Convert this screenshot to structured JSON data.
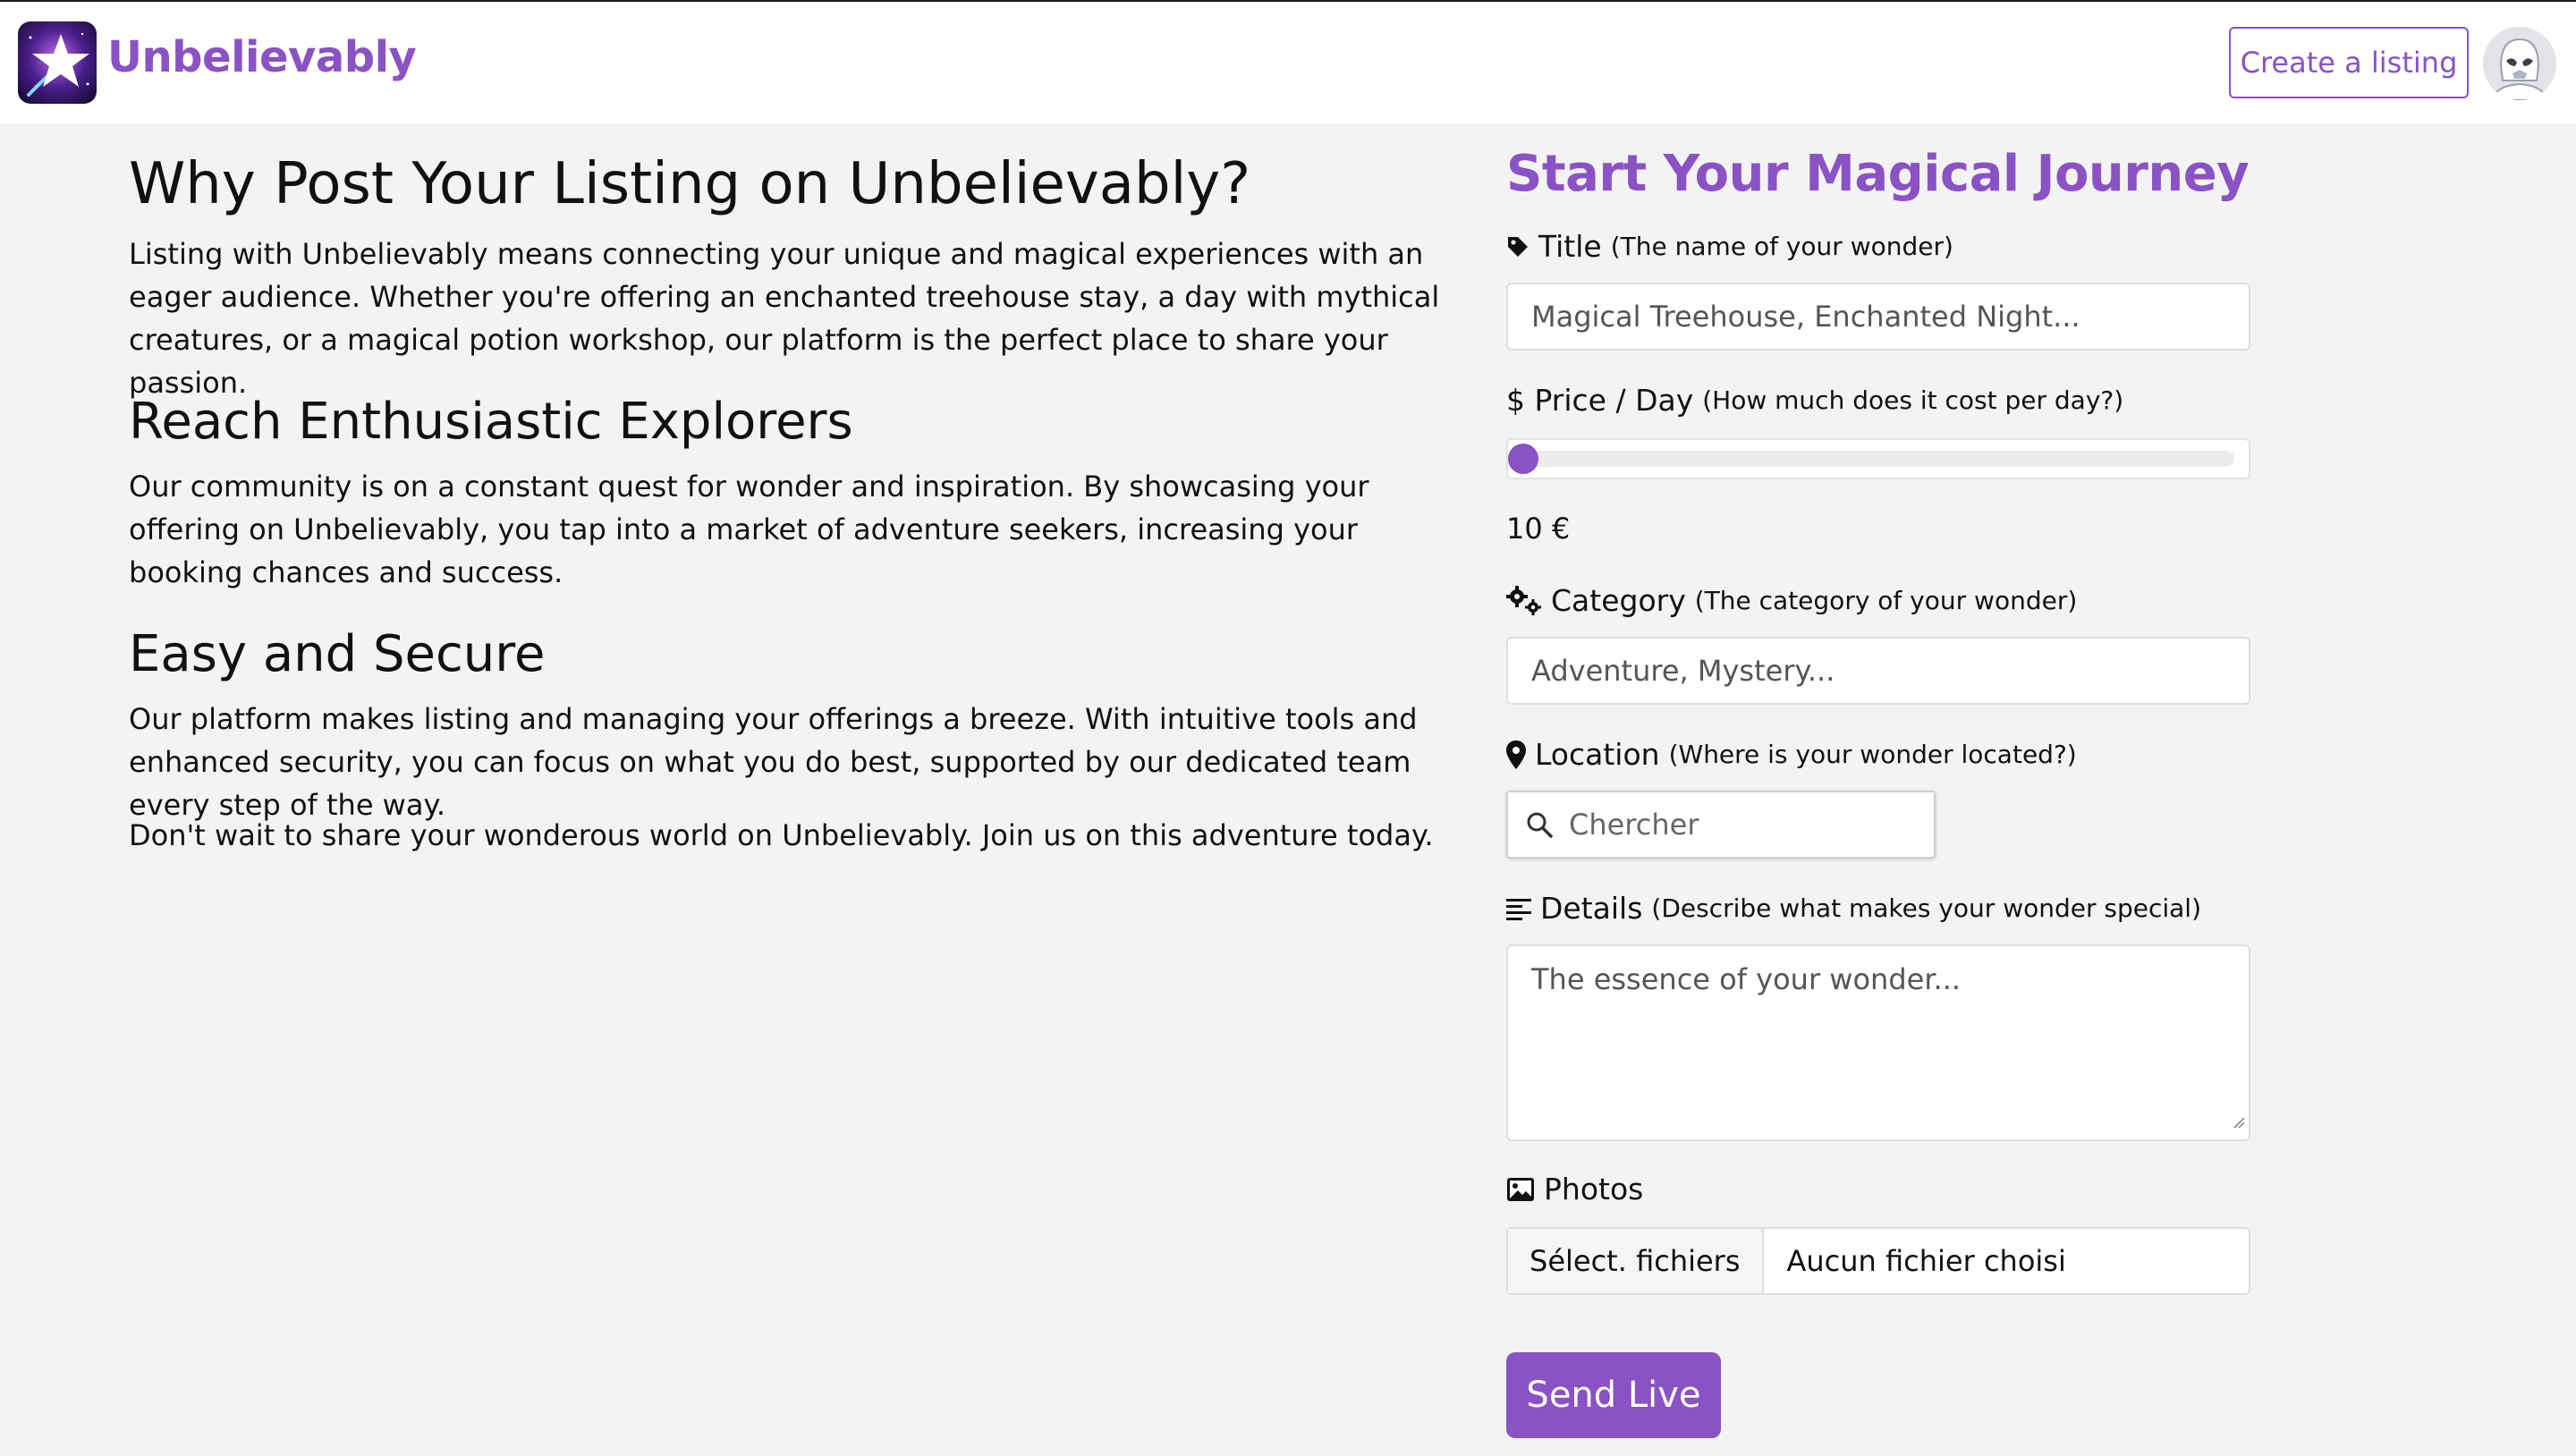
{
  "header": {
    "brand": "Unbelievably",
    "create_label": "Create a listing"
  },
  "left": {
    "title": "Why Post Your Listing on Unbelievably?",
    "intro": "Listing with Unbelievably means connecting your unique and magical experiences with an eager audience. Whether you're offering an enchanted treehouse stay, a day with mythical creatures, or a magical potion workshop, our platform is the perfect place to share your passion.",
    "section1_title": "Reach Enthusiastic Explorers",
    "section1_text": "Our community is on a constant quest for wonder and inspiration. By showcasing your offering on Unbelievably, you tap into a market of adventure seekers, increasing your booking chances and success.",
    "section2_title": "Easy and Secure",
    "section2_text": "Our platform makes listing and managing your offerings a breeze. With intuitive tools and enhanced security, you can focus on what you do best, supported by our dedicated team every step of the way.",
    "closing": "Don't wait to share your wonderous world on Unbelievably. Join us on this adventure today."
  },
  "form": {
    "heading": "Start Your Magical Journey",
    "title_label": "Title",
    "title_hint": "(The name of your wonder)",
    "title_placeholder": "Magical Treehouse, Enchanted Night...",
    "price_label": "$ Price / Day",
    "price_hint": "(How much does it cost per day?)",
    "price_value": "10 €",
    "price_slider_fraction": 0.0,
    "category_label": "Category",
    "category_hint": "(The category of your wonder)",
    "category_placeholder": "Adventure, Mystery...",
    "location_label": "Location",
    "location_hint": "(Where is your wonder located?)",
    "search_placeholder": "Chercher",
    "details_label": "Details",
    "details_hint": "(Describe what makes your wonder special)",
    "details_placeholder": "The essence of your wonder...",
    "photos_label": "Photos",
    "file_button": "Sélect. fichiers",
    "file_status": "Aucun fichier choisi",
    "submit_label": "Send Live"
  },
  "colors": {
    "accent": "#8a52c4",
    "background": "#f3f3f3"
  },
  "icons": {
    "logo": "star-logo-icon",
    "avatar": "stormtrooper-avatar-icon",
    "title": "tag-icon",
    "category": "gears-icon",
    "location": "map-pin-icon",
    "search": "search-icon",
    "details": "align-left-icon",
    "photos": "image-icon"
  }
}
